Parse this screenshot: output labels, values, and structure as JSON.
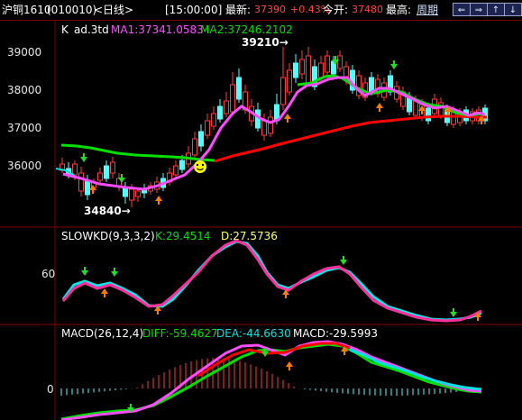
{
  "header": {
    "symbol": "沪铜1610",
    "code": "(010010)",
    "period": "<日线>",
    "time": "[15:00:00]",
    "last_label": "最新:",
    "last_value": "37390",
    "change": "+0.43%",
    "open_label": "今开:",
    "open_value": "37480",
    "high_label": "最高:",
    "period_link": "周期",
    "buttons": [
      "⇐",
      "⇒",
      "↑",
      "↓"
    ]
  },
  "colors": {
    "bg": "#000000",
    "up": "#ff3c3c",
    "down": "#54ffff",
    "ma1": "#ff4cff",
    "ma2": "#00e000",
    "red_line": "#ff0000",
    "divider": "#800000",
    "text": "#e6e6e6",
    "accent_red": "#ff4444",
    "accent_yellow": "#ffff00"
  },
  "panels": {
    "main": {
      "title_k": "K",
      "title_name": "ad.3td",
      "ma1_label": "MA1:37341.0583",
      "ma2_label": "MA2:37246.2102",
      "y_ticks": [
        "39000",
        "38000",
        "37000",
        "36000"
      ],
      "high_annotation": "39210→",
      "low_annotation": "34840→"
    },
    "kd": {
      "title": "SLOWKD(9,3,3,2)",
      "k_label": "K:29.4514",
      "d_label": "D:27.5736",
      "y_ticks": [
        "60"
      ]
    },
    "macd": {
      "title": "MACD(26,12,4)",
      "diff_label": "DIFF:-59.4627",
      "dea_label": "DEA:-44.6630",
      "macd_label": "MACD:-29.5993",
      "y_ticks": [
        "0"
      ]
    }
  }
}
